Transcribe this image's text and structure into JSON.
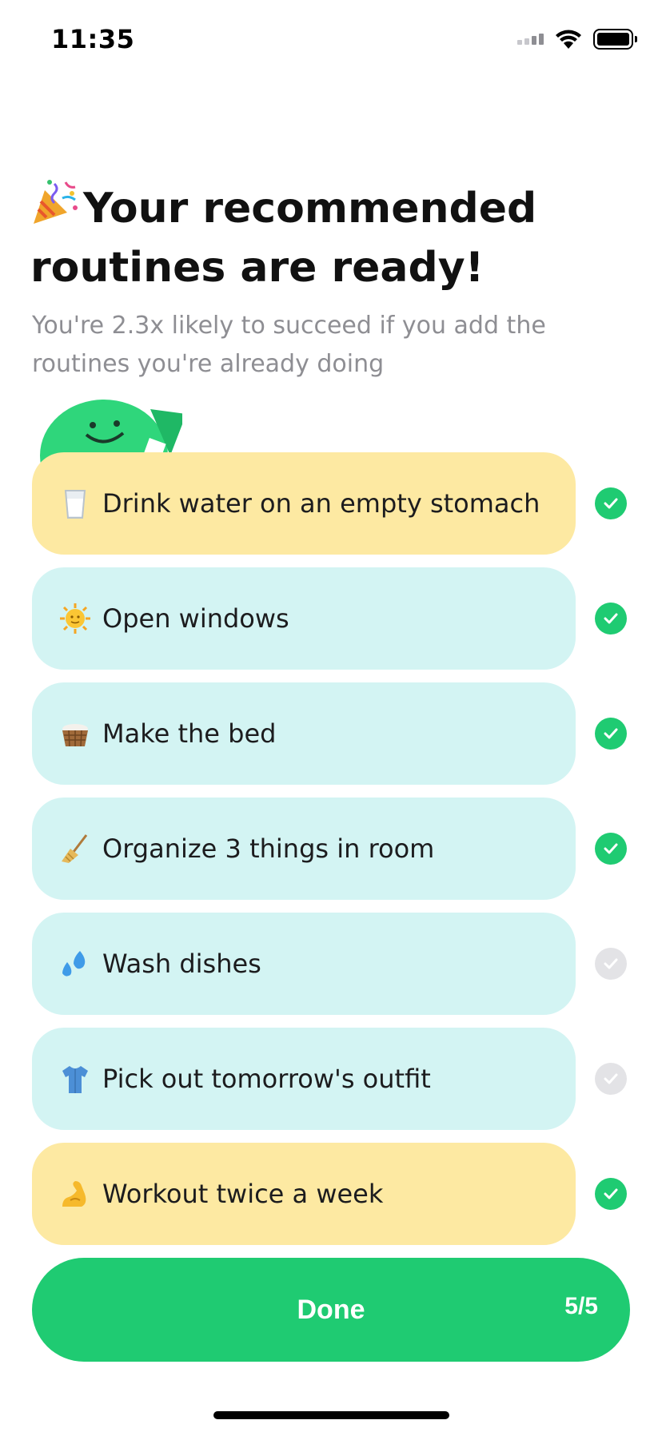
{
  "status_bar": {
    "time": "11:35"
  },
  "header": {
    "emoji_icon": "party-popper-icon",
    "title": "Your recommended routines are ready!",
    "subtitle": "You're 2.3x likely to succeed if you add the routines you're already doing"
  },
  "routines": [
    {
      "icon": "milk-glass-icon",
      "label": "Drink water on an empty stomach",
      "selected": true,
      "color": "yellow"
    },
    {
      "icon": "sun-face-icon",
      "label": "Open windows",
      "selected": true,
      "color": "blue"
    },
    {
      "icon": "basket-icon",
      "label": "Make the bed",
      "selected": true,
      "color": "blue"
    },
    {
      "icon": "broom-icon",
      "label": "Organize 3 things in room",
      "selected": true,
      "color": "blue"
    },
    {
      "icon": "sweat-droplets-icon",
      "label": "Wash dishes",
      "selected": false,
      "color": "blue"
    },
    {
      "icon": "shirt-icon",
      "label": "Pick out tomorrow's outfit",
      "selected": false,
      "color": "blue"
    },
    {
      "icon": "flexed-biceps-icon",
      "label": "Workout twice a week",
      "selected": true,
      "color": "yellow"
    }
  ],
  "done_button": {
    "label": "Done",
    "count": "5/5"
  },
  "colors": {
    "accent_green": "#1fcb72",
    "card_yellow": "#fde9a2",
    "card_blue": "#d3f4f3",
    "check_off": "#e3e3e6",
    "subtitle_gray": "#8e8e93"
  }
}
